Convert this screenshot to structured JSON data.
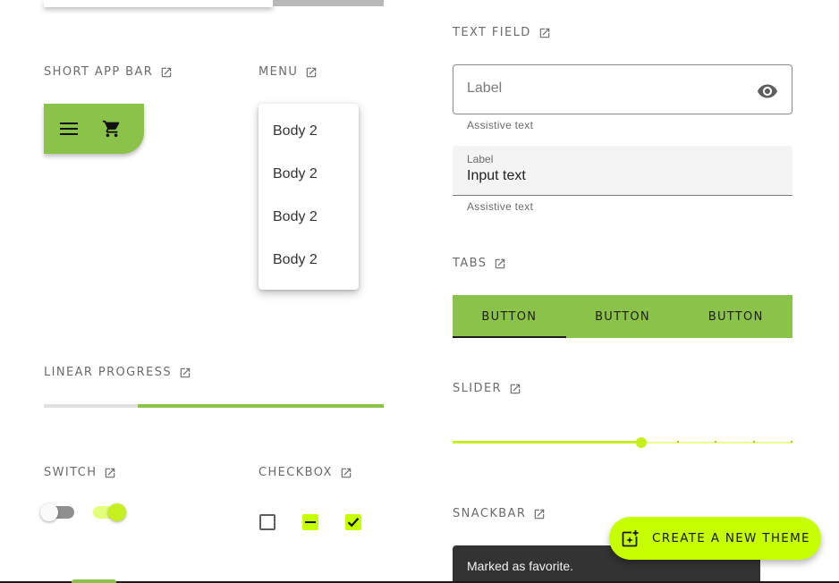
{
  "colors": {
    "primary": "#8bc34a",
    "secondary": "#c6ff00",
    "snackbar": "#333333"
  },
  "sections": {
    "short_app_bar": "SHORT APP BAR",
    "menu": "MENU",
    "linear_progress": "LINEAR PROGRESS",
    "switch": "SWITCH",
    "checkbox": "CHECKBOX",
    "text_field": "TEXT FIELD",
    "tabs": "TABS",
    "slider": "SLIDER",
    "snackbar": "SNACKBAR"
  },
  "app_bar": {
    "icons": [
      "menu-icon",
      "cart-icon"
    ]
  },
  "menu": {
    "items": [
      "Body 2",
      "Body 2",
      "Body 2",
      "Body 2"
    ]
  },
  "progress": {
    "value_fraction": 0.72
  },
  "switch": {
    "states": [
      false,
      true
    ]
  },
  "checkbox": {
    "states": [
      "unchecked",
      "indeterminate",
      "checked"
    ]
  },
  "text_field": {
    "outlined": {
      "label": "Label",
      "assistive": "Assistive text",
      "trailing_icon": "eye-icon"
    },
    "filled": {
      "label": "Label",
      "value": "Input text",
      "assistive": "Assistive text"
    }
  },
  "tabs": {
    "items": [
      "BUTTON",
      "BUTTON",
      "BUTTON"
    ],
    "active_index": 0
  },
  "slider": {
    "value_fraction": 0.555
  },
  "snackbar": {
    "message": "Marked as favorite."
  },
  "fab": {
    "label": "CREATE A NEW THEME",
    "icon": "new-theme-icon"
  }
}
